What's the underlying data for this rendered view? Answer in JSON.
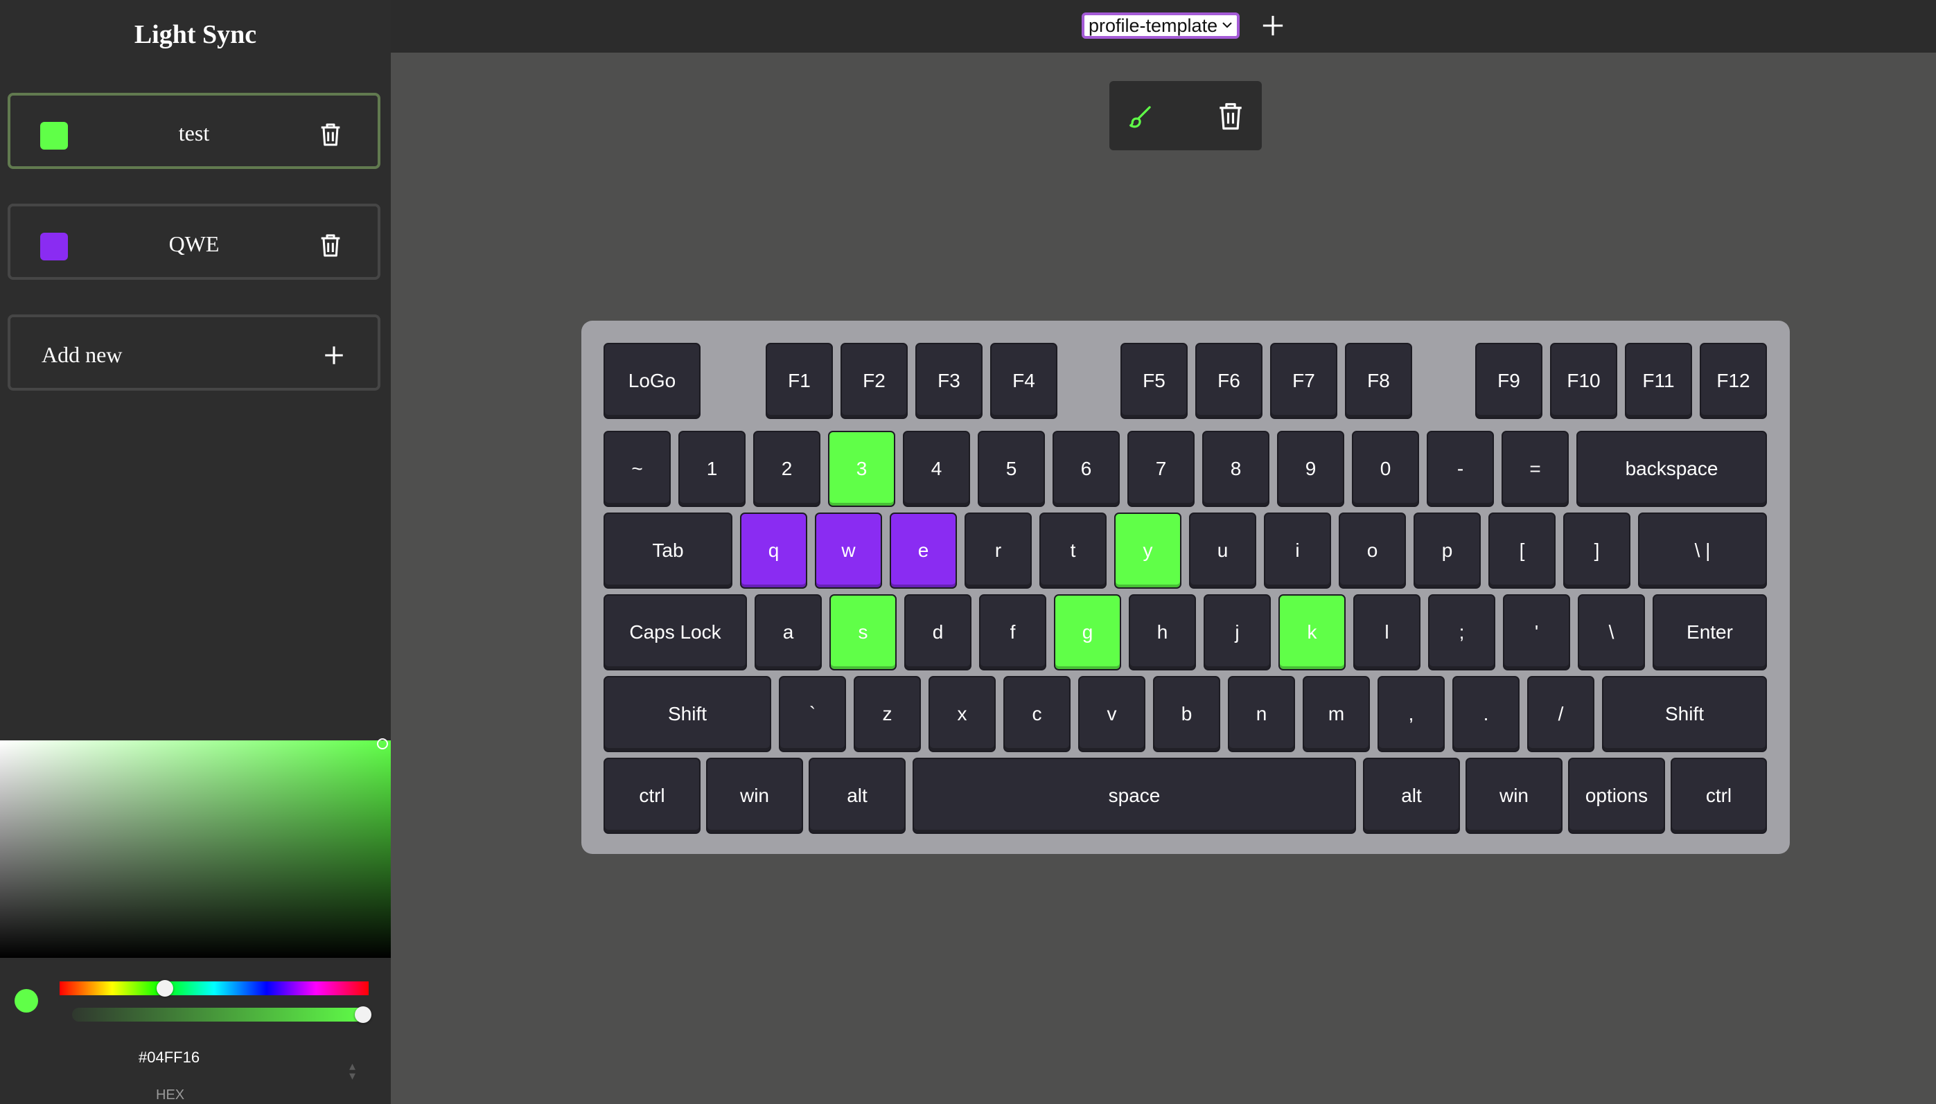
{
  "app": {
    "title": "Light Sync"
  },
  "profiles": [
    {
      "name": "test",
      "color": "#60ff48",
      "active": true
    },
    {
      "name": "QWE",
      "color": "#8a2cf2",
      "active": false
    }
  ],
  "add_new": {
    "label": "Add new"
  },
  "color_picker": {
    "hex": "#04FF16",
    "format_label": "HEX",
    "preview_color": "#60ff48",
    "hue_level": 0.34,
    "alpha_level": 1.0
  },
  "topbar": {
    "profile_select": {
      "selected": "profile-template"
    }
  },
  "colors": {
    "green_key": "#60ff48",
    "purple_key": "#8a2cf2",
    "key_default": "#2c2b35",
    "keyboard_frame": "#a2a2a7"
  },
  "keyboard": {
    "rows": [
      [
        "LoGo",
        "F1",
        "F2",
        "F3",
        "F4",
        "F5",
        "F6",
        "F7",
        "F8",
        "F9",
        "F10",
        "F11",
        "F12"
      ],
      [
        "~",
        "1",
        "2",
        "3",
        "4",
        "5",
        "6",
        "7",
        "8",
        "9",
        "0",
        "-",
        "=",
        "backspace"
      ],
      [
        "Tab",
        "q",
        "w",
        "e",
        "r",
        "t",
        "y",
        "u",
        "i",
        "o",
        "p",
        "[",
        "]",
        "\\ |"
      ],
      [
        "Caps Lock",
        "a",
        "s",
        "d",
        "f",
        "g",
        "h",
        "j",
        "k",
        "l",
        ";",
        "'",
        "\\",
        "Enter"
      ],
      [
        "Shift",
        "`",
        "z",
        "x",
        "c",
        "v",
        "b",
        "n",
        "m",
        ",",
        ".",
        "/",
        "Shift"
      ],
      [
        "ctrl",
        "win",
        "alt",
        "space",
        "alt",
        "win",
        "options",
        "ctrl"
      ]
    ],
    "highlighted_green": [
      "3",
      "y",
      "s",
      "g",
      "k"
    ],
    "highlighted_purple": [
      "q",
      "w",
      "e"
    ]
  }
}
